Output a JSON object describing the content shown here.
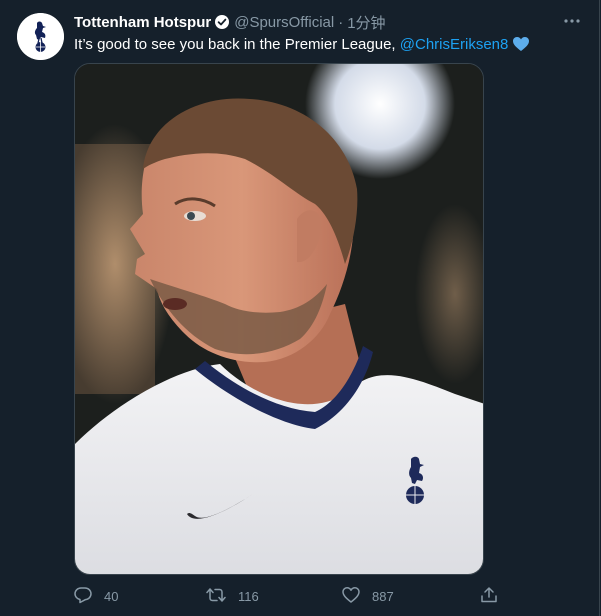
{
  "tweet": {
    "display_name": "Tottenham Hotspur",
    "handle": "@SpursOfficial",
    "separator": "·",
    "time": "1分钟",
    "text_prefix": "It’s good to see you back in the Premier League, ",
    "mention": "@ChrisEriksen8",
    "emoji": "blue-heart-icon"
  },
  "actions": {
    "replies": "40",
    "retweets": "116",
    "likes": "887"
  },
  "icons": {
    "avatar": "tottenham-cockerel-logo",
    "verified": "verified-badge-icon",
    "more": "more-options-icon",
    "reply": "reply-icon",
    "retweet": "retweet-icon",
    "like": "heart-icon",
    "share": "share-icon"
  },
  "colors": {
    "background": "#15202b",
    "text": "#ffffff",
    "muted": "#8899a6",
    "accent": "#1da1f2",
    "heart_emoji": "#5dadec"
  }
}
